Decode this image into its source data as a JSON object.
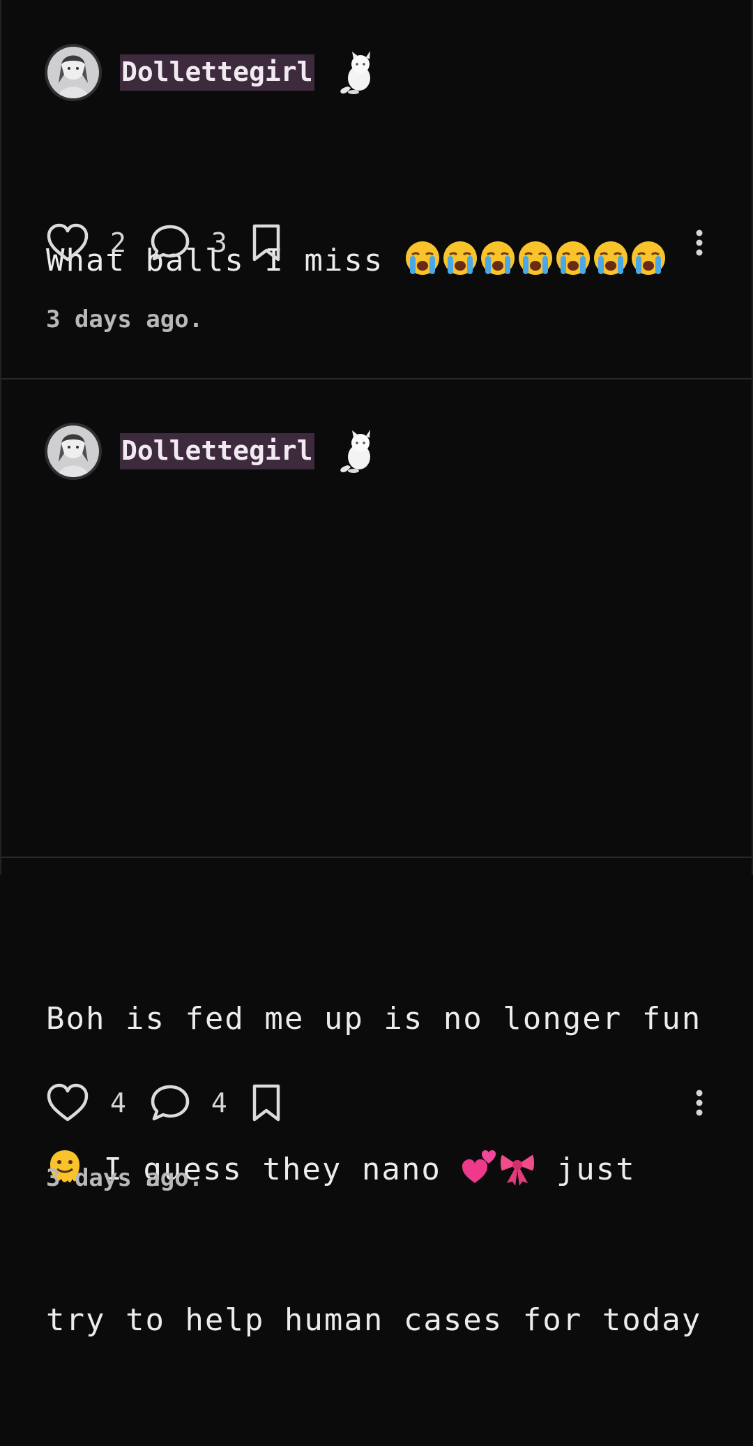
{
  "posts": [
    {
      "username": "Dollettegirl",
      "lines": [
        {
          "text": "What balls I miss ",
          "emojis": [
            "loudly-crying-face",
            "loudly-crying-face",
            "loudly-crying-face",
            "loudly-crying-face",
            "loudly-crying-face",
            "loudly-crying-face",
            "loudly-crying-face"
          ]
        }
      ],
      "likes": "2",
      "comments": "3",
      "time": "3 days ago."
    },
    {
      "username": "Dollettegirl",
      "lines_text": {
        "l1": "Boh is fed me up is no longer fun",
        "l2a": " I guess they nano ",
        "l2b": " just",
        "l3": "try to help human cases for today"
      },
      "emojis": [
        "melting-face",
        "two-hearts",
        "ribbon"
      ],
      "likes": "4",
      "comments": "4",
      "time": "3 days ago."
    }
  ],
  "colors": {
    "background": "#0b0b0c",
    "username_highlight": "#3d2a3d",
    "text": "#ececed",
    "muted": "#b9b9bc"
  },
  "icons": [
    "avatar",
    "cat-icon",
    "heart-icon",
    "comment-icon",
    "bookmark-icon",
    "more-vertical-icon"
  ]
}
